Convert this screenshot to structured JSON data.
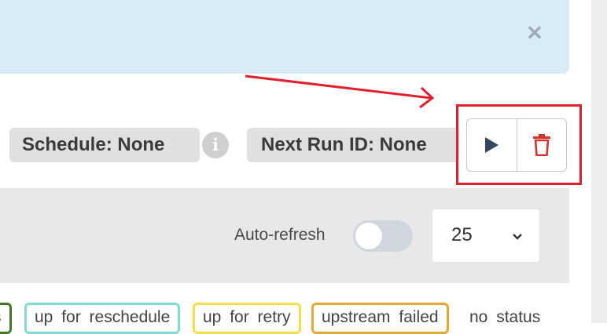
{
  "alert": {
    "close_symbol": "×"
  },
  "dag_info": {
    "schedule_label": "Schedule: None",
    "info_symbol": "i",
    "next_run_label": "Next Run ID: None"
  },
  "actions": {
    "trigger_icon": "play-icon",
    "delete_icon": "trash-icon",
    "highlight_color": "#e0202f"
  },
  "toolbar": {
    "auto_refresh_label": "Auto-refresh",
    "auto_refresh_on": false,
    "page_size_value": "25"
  },
  "legend": {
    "items": [
      {
        "label": "s",
        "color": "#3c7a28"
      },
      {
        "label": "up for reschedule",
        "color": "#80dcd2"
      },
      {
        "label": "up for retry",
        "color": "#f0e04a"
      },
      {
        "label": "upstream failed",
        "color": "#e6a733"
      },
      {
        "label": "no status",
        "color": "none"
      }
    ]
  }
}
